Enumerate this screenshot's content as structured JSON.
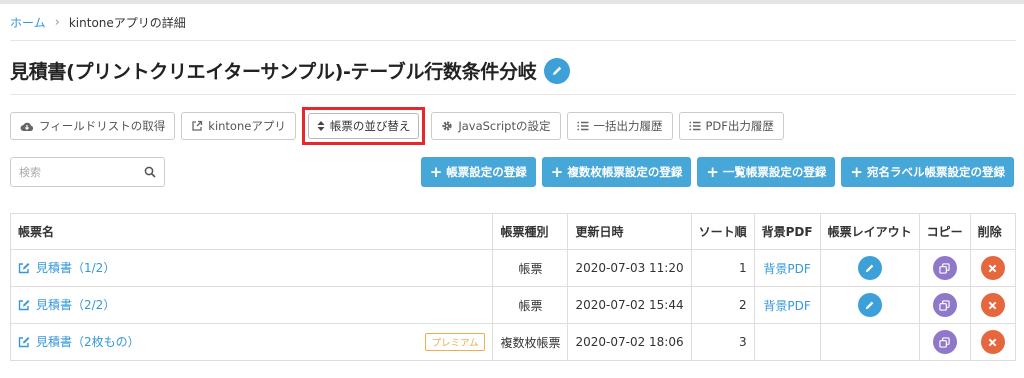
{
  "breadcrumb": {
    "home": "ホーム",
    "separator": "›",
    "current": "kintoneアプリの詳細"
  },
  "page": {
    "title": "見積書(プリントクリエイターサンプル)-テーブル行数条件分岐"
  },
  "toolbar": {
    "field_list": "フィールドリストの取得",
    "kintone_app": "kintoneアプリ",
    "sort": "帳票の並び替え",
    "javascript": "JavaScriptの設定",
    "batch_history": "一括出力履歴",
    "pdf_history": "PDF出力履歴"
  },
  "search": {
    "placeholder": "検索",
    "value": ""
  },
  "actions": {
    "add_form": "帳票設定の登録",
    "add_multi": "複数枚帳票設定の登録",
    "add_list": "一覧帳票設定の登録",
    "add_label": "宛名ラベル帳票設定の登録"
  },
  "table": {
    "headers": {
      "name": "帳票名",
      "type": "帳票種別",
      "updated": "更新日時",
      "sort": "ソート順",
      "bg": "背景PDF",
      "layout": "帳票レイアウト",
      "copy": "コピー",
      "delete": "削除"
    },
    "rows": [
      {
        "name": "見積書（1/2）",
        "badge": "",
        "type": "帳票",
        "updated": "2020-07-03 11:20",
        "sort": "1",
        "bg": "背景PDF"
      },
      {
        "name": "見積書（2/2）",
        "badge": "",
        "type": "帳票",
        "updated": "2020-07-02 15:44",
        "sort": "2",
        "bg": "背景PDF"
      },
      {
        "name": "見積書（2枚もの）",
        "badge": "プレミアム",
        "type": "複数枚帳票",
        "updated": "2020-07-02 18:06",
        "sort": "3",
        "bg": ""
      }
    ]
  },
  "colors": {
    "accent": "#48a7d9",
    "link": "#3498db",
    "highlight": "#e8262b",
    "purple": "#8f77c9",
    "red": "#e5673e",
    "badge": "#f0ad4e"
  }
}
